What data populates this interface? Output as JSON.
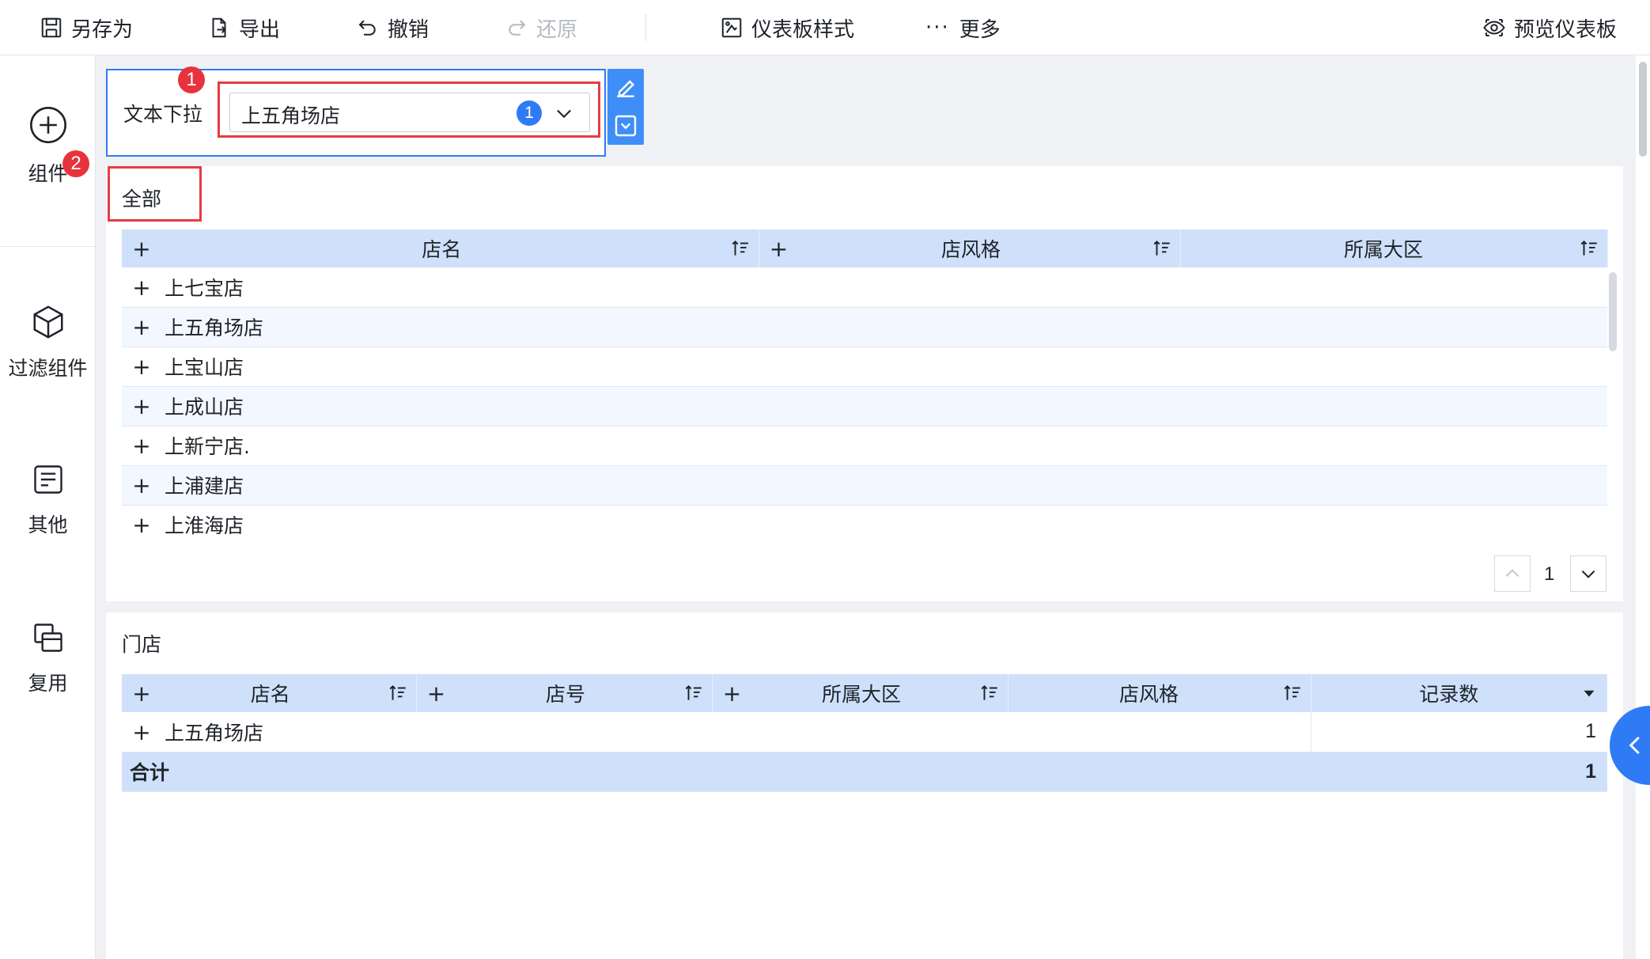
{
  "toolbar": {
    "save_as": "另存为",
    "export": "导出",
    "undo": "撤销",
    "redo": "还原",
    "dashboard_style": "仪表板样式",
    "more": "更多",
    "preview": "预览仪表板"
  },
  "sidebar": {
    "components": "组件",
    "filter_components": "过滤组件",
    "others": "其他",
    "reuse": "复用"
  },
  "badges": {
    "first": "1",
    "second": "2"
  },
  "filter": {
    "label": "文本下拉",
    "selected": "上五角场店",
    "count": "1"
  },
  "table1": {
    "title": "全部",
    "headers": [
      "店名",
      "店风格",
      "所属大区"
    ],
    "rows": [
      "上七宝店",
      "上五角场店",
      "上宝山店",
      "上成山店",
      "上新宁店.",
      "上浦建店",
      "上淮海店"
    ],
    "page": "1"
  },
  "table2": {
    "title": "门店",
    "headers": [
      "店名",
      "店号",
      "所属大区",
      "店风格",
      "记录数"
    ],
    "row": {
      "name": "上五角场店",
      "count": "1"
    },
    "total": {
      "label": "合计",
      "value": "1"
    }
  },
  "colors": {
    "accent": "#2f7bf5",
    "header_bg": "#cfe0fb",
    "highlight_red": "#e53c43"
  }
}
